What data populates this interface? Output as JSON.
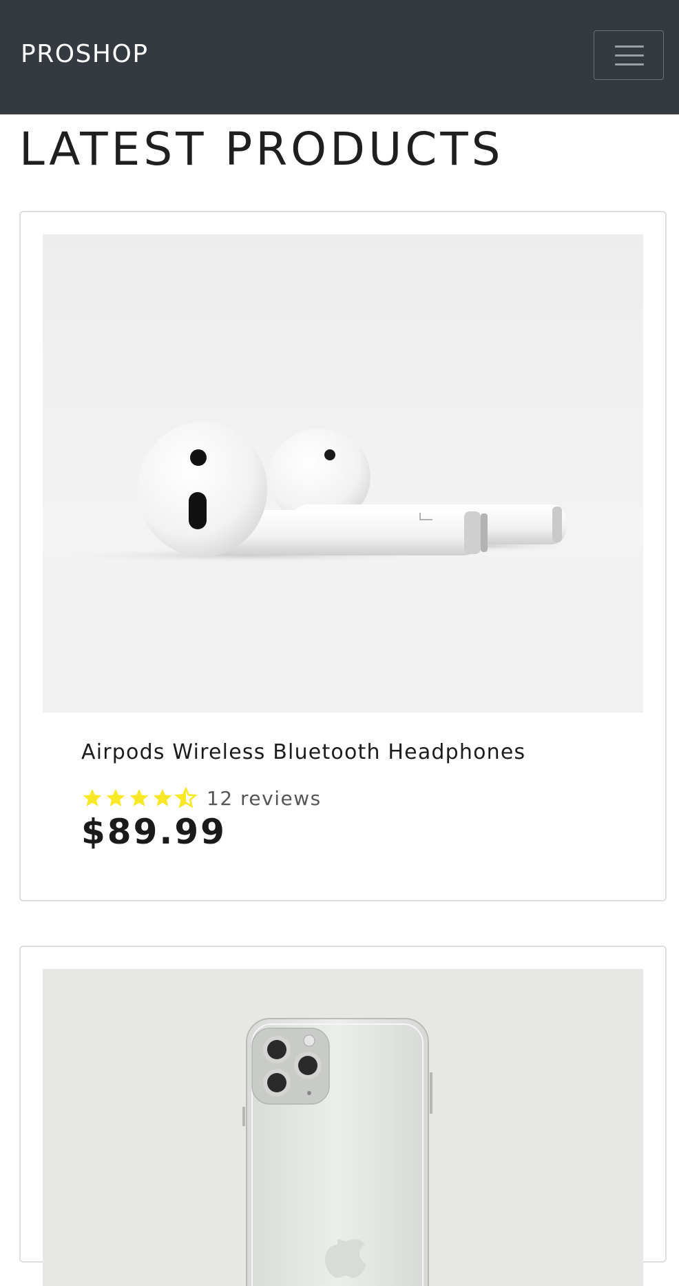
{
  "navbar": {
    "brand": "PROSHOP",
    "toggler_icon": "hamburger-menu-icon"
  },
  "main": {
    "title": "LATEST PRODUCTS",
    "products": [
      {
        "name": "Airpods Wireless Bluetooth Headphones",
        "image": "airpods-image",
        "rating": 4.5,
        "reviews": "12 reviews",
        "price": "$89.99"
      },
      {
        "image": "iphone-image"
      }
    ]
  },
  "colors": {
    "navbar": "#343a40",
    "star": "#f8e825",
    "text": "#1a1a1a"
  }
}
